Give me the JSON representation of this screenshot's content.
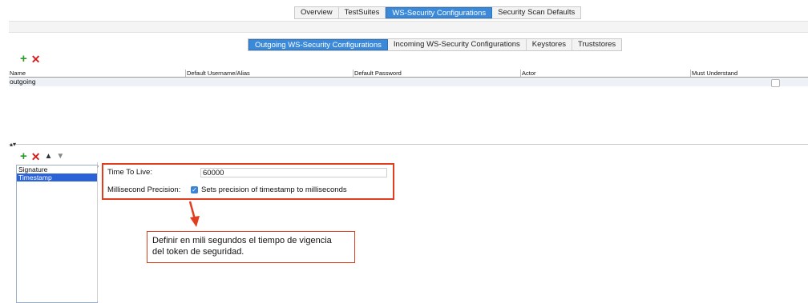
{
  "top_tabs": [
    {
      "label": "Overview",
      "active": false
    },
    {
      "label": "TestSuites",
      "active": false
    },
    {
      "label": "WS-Security Configurations",
      "active": true
    },
    {
      "label": "Security Scan Defaults",
      "active": false
    }
  ],
  "sub_tabs": [
    {
      "label": "Outgoing WS-Security Configurations",
      "active": true
    },
    {
      "label": "Incoming WS-Security Configurations",
      "active": false
    },
    {
      "label": "Keystores",
      "active": false
    },
    {
      "label": "Truststores",
      "active": false
    }
  ],
  "table": {
    "columns": [
      "Name",
      "Default Username/Alias",
      "Default Password",
      "Actor",
      "Must Understand"
    ],
    "rows": [
      {
        "name": "outgoing",
        "must_understand": false
      }
    ]
  },
  "entries": {
    "items": [
      "Signature",
      "Timestamp"
    ],
    "selected_index": 1
  },
  "timestamp_form": {
    "ttl_label": "Time To Live:",
    "ttl_value": "60000",
    "precision_label": "Millisecond Precision:",
    "precision_checkbox_label": "Sets precision of timestamp to milliseconds",
    "precision_checked": true
  },
  "annotation": {
    "line1": "Definir en mili segundos el tiempo de vigencia",
    "line2": "del token de seguridad."
  },
  "colors": {
    "accent": "#3b8ad9",
    "annotation": "#e03e1f",
    "selection": "#2b62d6"
  },
  "icons": [
    "plus-icon",
    "delete-x-icon",
    "move-up-icon",
    "move-down-icon",
    "checkmark-icon",
    "red-arrow-icon"
  ]
}
